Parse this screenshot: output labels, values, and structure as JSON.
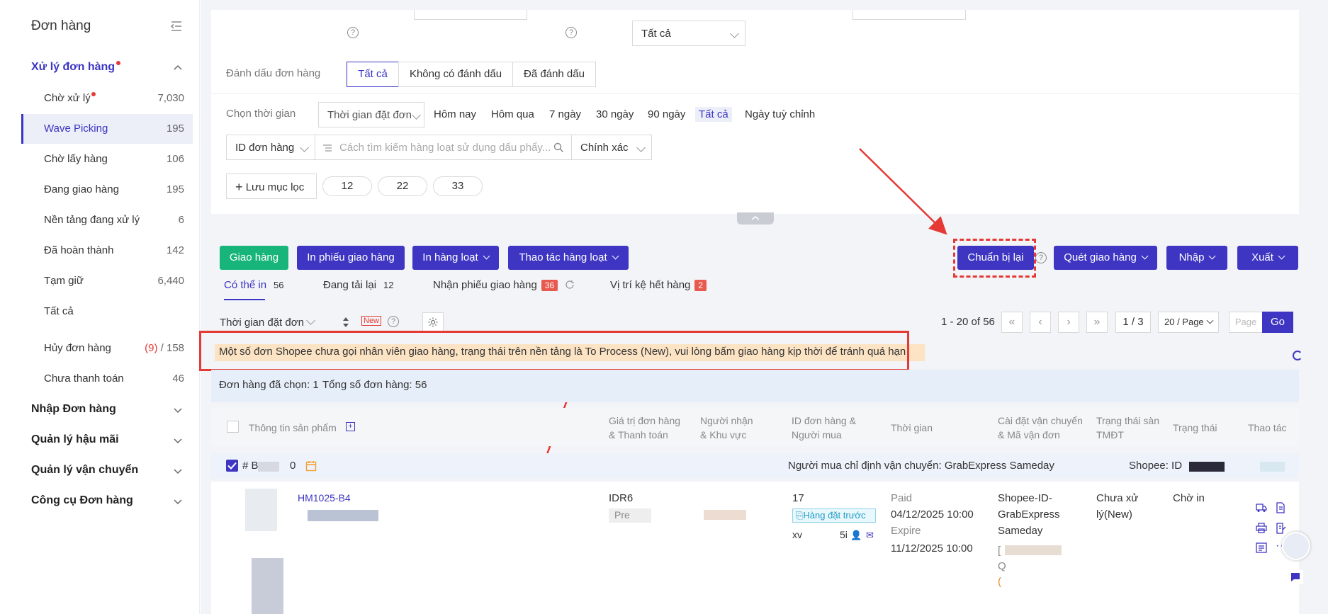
{
  "sidebar": {
    "title": "Đơn hàng",
    "groups": {
      "processing": "Xử lý đơn hàng",
      "import": "Nhập Đơn hàng",
      "after_sales": "Quản lý hậu mãi",
      "shipping": "Quản lý vận chuyển",
      "tools": "Công cụ Đơn hàng"
    },
    "items": [
      {
        "label": "Chờ xử lý",
        "count": "7,030"
      },
      {
        "label": "Wave Picking",
        "count": "195"
      },
      {
        "label": "Chờ lấy hàng",
        "count": "106"
      },
      {
        "label": "Đang giao hàng",
        "count": "195"
      },
      {
        "label": "Nền tảng đang xử lý",
        "count": "6"
      },
      {
        "label": "Đã hoàn thành",
        "count": "142"
      },
      {
        "label": "Tạm giữ",
        "count": "6,440"
      },
      {
        "label": "Tất cả",
        "count": ""
      },
      {
        "label": "Hủy đơn hàng",
        "count_red": "(9)",
        "count": " / 158"
      },
      {
        "label": "Chưa thanh toán",
        "count": "46"
      }
    ]
  },
  "filters": {
    "top_select": "Tất cả",
    "mark_label": "Đánh dấu đơn hàng",
    "mark_options": [
      "Tất cả",
      "Không có đánh dấu",
      "Đã đánh dấu"
    ],
    "time_label": "Chọn thời gian",
    "time_type": "Thời gian đặt đơn",
    "time_options": [
      "Hôm nay",
      "Hôm qua",
      "7 ngày",
      "30 ngày",
      "90 ngày",
      "Tất cả",
      "Ngày tuỳ chỉnh"
    ],
    "id_type": "ID đơn hàng",
    "search_placeholder": "Cách tìm kiếm hàng loạt sử dụng dấu phẩy...",
    "match_type": "Chính xác",
    "save_filter": "Lưu mục lọc",
    "saved_chips": [
      "12",
      "22",
      "33"
    ]
  },
  "toolbar": {
    "ship": "Giao hàng",
    "print_slip": "In phiếu giao hàng",
    "bulk_print": "In hàng loạt",
    "bulk_action": "Thao tác hàng loạt",
    "reprepare": "Chuẩn bị lại",
    "scan_ship": "Quét giao hàng",
    "import": "Nhập",
    "export": "Xuất"
  },
  "subtabs": [
    {
      "label": "Có thể in",
      "count": "56"
    },
    {
      "label": "Đang tải lại",
      "count": "12"
    },
    {
      "label": "Nhận phiếu giao hàng",
      "count": "36"
    },
    {
      "label": "Vị trí kệ hết hàng",
      "count": "2"
    }
  ],
  "sort": {
    "field": "Thời gian đặt đơn",
    "new_badge": "New"
  },
  "pagination": {
    "range": "1 - 20 of 56",
    "page": "1 / 3",
    "page_size": "20 / Page",
    "page_placeholder": "Page",
    "go": "Go"
  },
  "notice": "Một số đơn Shopee chưa gọi nhân viên giao hàng, trạng thái trên nền tảng là To Process (New), vui lòng bấm giao hàng kịp thời để tránh quá hạn",
  "selection": {
    "selected": "Đơn hàng đã chọn: 1",
    "total": "Tổng số đơn hàng: 56"
  },
  "table": {
    "headers": {
      "product": "Thông tin sản phẩm",
      "value_1": "Giá trị đơn hàng",
      "value_2": "& Thanh toán",
      "receiver_1": "Người nhận",
      "receiver_2": "& Khu vực",
      "orderid_1": "ID đơn hàng &",
      "orderid_2": "Người mua",
      "time": "Thời gian",
      "ship_1": "Cài đặt vận chuyển",
      "ship_2": "& Mã vận đơn",
      "platform_1": "Trạng thái sàn",
      "platform_2": "TMĐT",
      "status": "Trạng thái",
      "action": "Thao tác"
    },
    "order": {
      "prefix": "# B",
      "zero": "0",
      "buyer_carrier": "Người mua chỉ định vận chuyển: GrabExpress Sameday",
      "shop": "Shopee: ID",
      "sku": "HM1025-B4",
      "value": "IDR6",
      "value_sub": "Pre",
      "order_id": "17",
      "preorder": "Hàng đặt trước",
      "buyer": "xv",
      "buyer_suffix": "5i",
      "paid_label": "Paid",
      "paid_time": "04/12/2025 10:00",
      "expire_label": "Expire",
      "expire_time": "11/12/2025 10:00",
      "carrier": "Shopee-ID-GrabExpress Sameday",
      "tracking_prefix": "[",
      "tracking_q": "Q",
      "tracking_tail": "(",
      "platform_status": "Chưa xử lý(New)",
      "status": "Chờ in"
    }
  },
  "colors": {
    "accent": "#3e35c2",
    "green": "#18b57a",
    "annotation": "#e53935",
    "notice_bg": "#fce3c4"
  }
}
